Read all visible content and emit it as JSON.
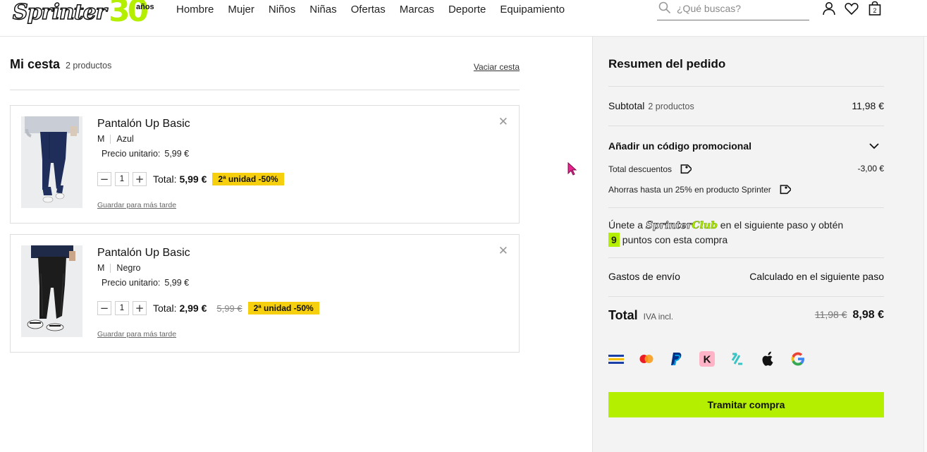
{
  "header": {
    "logo_text": "Sprinter",
    "logo_badge_number": "30",
    "logo_badge_suffix": "años",
    "nav": [
      "Hombre",
      "Mujer",
      "Niños",
      "Niñas",
      "Ofertas",
      "Marcas",
      "Deporte",
      "Equipamiento"
    ],
    "search_placeholder": "¿Qué buscas?",
    "cart_count": "2",
    "icons": [
      "search-icon",
      "user-icon",
      "heart-icon",
      "bag-icon"
    ]
  },
  "basket": {
    "title": "Mi cesta",
    "count": "2 productos",
    "empty_label": "Vaciar cesta",
    "items": [
      {
        "name": "Pantalón Up Basic",
        "size": "M",
        "color": "Azul",
        "unit_label": "Precio unitario:",
        "unit_price": "5,99 €",
        "quantity": "1",
        "total_label": "Total:",
        "total": "5,99 €",
        "old_price": "",
        "badge": "2ª unidad -50%",
        "save_label": "Guardar para más tarde"
      },
      {
        "name": "Pantalón Up Basic",
        "size": "M",
        "color": "Negro",
        "unit_label": "Precio unitario:",
        "unit_price": "5,99 €",
        "quantity": "1",
        "total_label": "Total:",
        "total": "2,99 €",
        "old_price": "5,99 €",
        "badge": "2ª unidad -50%",
        "save_label": "Guardar para más tarde"
      }
    ]
  },
  "summary": {
    "title": "Resumen del pedido",
    "subtotal_label": "Subtotal",
    "subtotal_count": "2 productos",
    "subtotal_value": "11,98 €",
    "promo_label": "Añadir un código promocional",
    "discounts_label": "Total descuentos",
    "discounts_value": "-3,00 €",
    "savings_text": "Ahorras hasta un 25% en producto Sprinter",
    "club_prefix": "Únete a",
    "club_logo_a": "Sprinter",
    "club_logo_b": "Club",
    "club_suffix": "en el siguiente paso y obtén",
    "club_points": "9",
    "club_points_text": "puntos con esta compra",
    "shipping_label": "Gastos de envío",
    "shipping_value": "Calculado en el siguiente paso",
    "total_label": "Total",
    "total_sub": "IVA incl.",
    "total_old": "11,98 €",
    "total_value": "8,98 €",
    "payment_methods": [
      "card-icon",
      "mastercard-icon",
      "paypal-icon",
      "klarna-icon",
      "zip-icon",
      "apple-icon",
      "google-icon"
    ],
    "checkout_label": "Tramitar compra"
  },
  "colors": {
    "accent_green": "#b4ef00",
    "badge_yellow": "#f6cf0e",
    "summary_bg": "#f3f3f3"
  }
}
